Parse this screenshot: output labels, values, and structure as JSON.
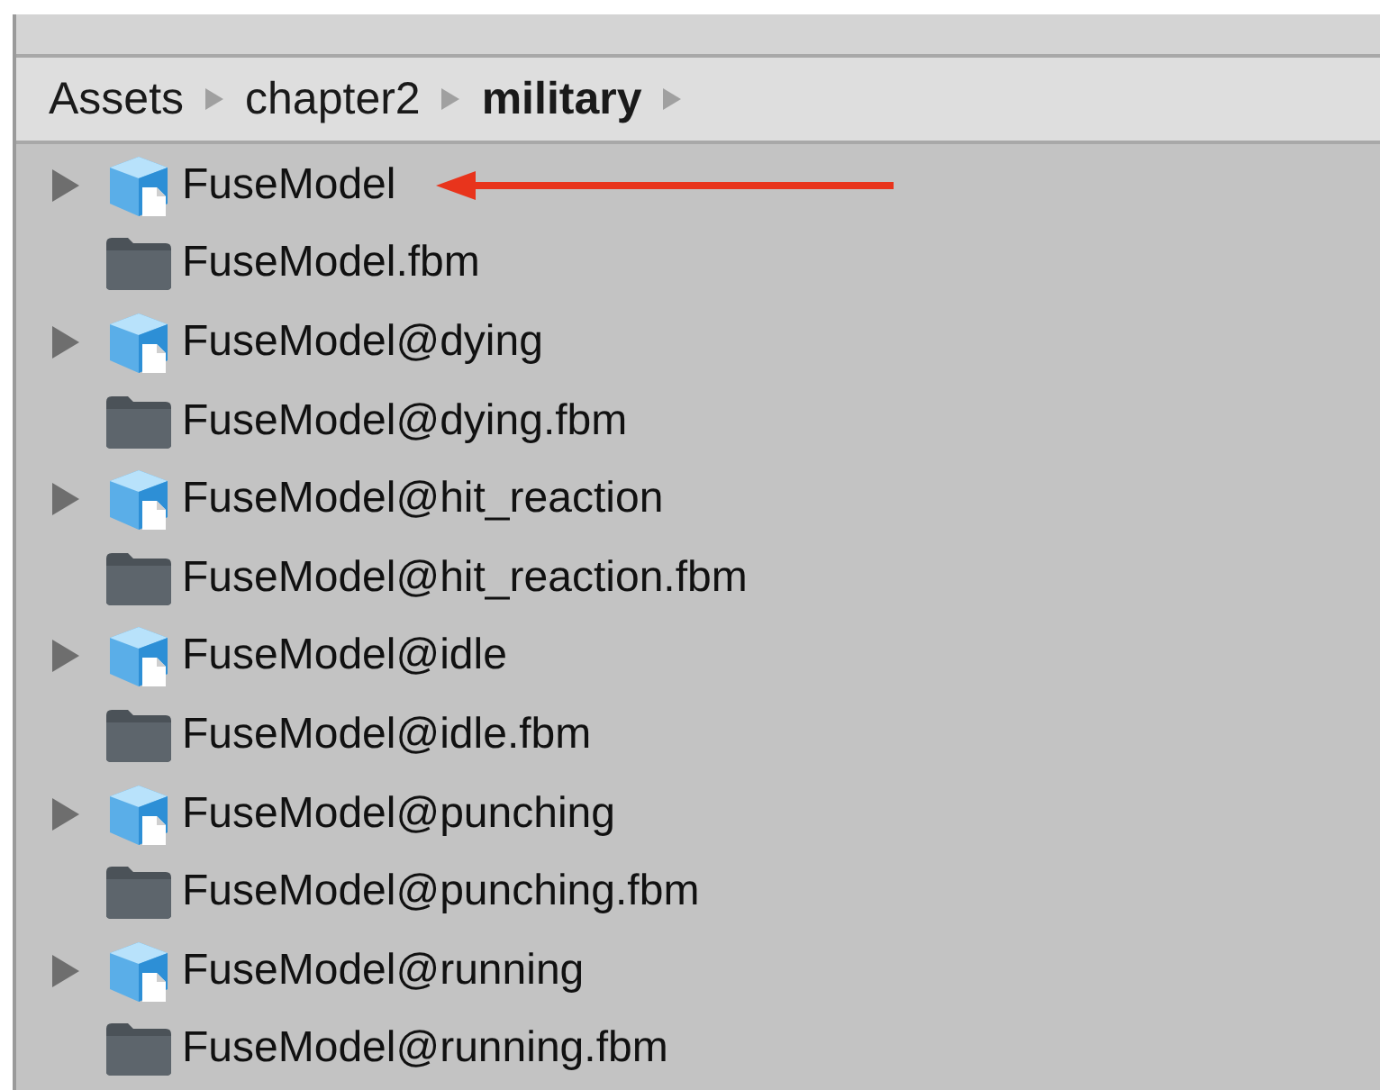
{
  "breadcrumb": [
    {
      "label": "Assets",
      "current": false
    },
    {
      "label": "chapter2",
      "current": false
    },
    {
      "label": "military",
      "current": true
    }
  ],
  "items": [
    {
      "kind": "model",
      "name": "FuseModel",
      "expanded": false,
      "marked": true
    },
    {
      "kind": "folder",
      "name": "FuseModel.fbm",
      "marked": false
    },
    {
      "kind": "model",
      "name": "FuseModel@dying",
      "expanded": false,
      "marked": false
    },
    {
      "kind": "folder",
      "name": "FuseModel@dying.fbm",
      "marked": false
    },
    {
      "kind": "model",
      "name": "FuseModel@hit_reaction",
      "expanded": false,
      "marked": false
    },
    {
      "kind": "folder",
      "name": "FuseModel@hit_reaction.fbm",
      "marked": false
    },
    {
      "kind": "model",
      "name": "FuseModel@idle",
      "expanded": false,
      "marked": false
    },
    {
      "kind": "folder",
      "name": "FuseModel@idle.fbm",
      "marked": false
    },
    {
      "kind": "model",
      "name": "FuseModel@punching",
      "expanded": false,
      "marked": false
    },
    {
      "kind": "folder",
      "name": "FuseModel@punching.fbm",
      "marked": false
    },
    {
      "kind": "model",
      "name": "FuseModel@running",
      "expanded": false,
      "marked": false
    },
    {
      "kind": "folder",
      "name": "FuseModel@running.fbm",
      "marked": false
    }
  ]
}
